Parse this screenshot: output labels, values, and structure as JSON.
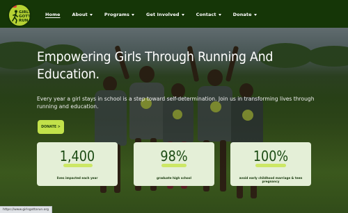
{
  "logo": {
    "pin_label": "Donate",
    "text_lines": [
      "GIRLS",
      "GOTTA",
      "RUN"
    ]
  },
  "nav": {
    "items": [
      {
        "label": "Home",
        "has_menu": false,
        "active": true
      },
      {
        "label": "About",
        "has_menu": true
      },
      {
        "label": "Programs",
        "has_menu": true
      },
      {
        "label": "Get Involved",
        "has_menu": true
      },
      {
        "label": "Contact",
        "has_menu": true
      },
      {
        "label": "Donate",
        "has_menu": true
      }
    ]
  },
  "hero": {
    "title": "Empowering Girls Through Running And Education.",
    "subtitle": "Every year a girl stays in school is a step toward self-determination. Join us in transforming lives through running and education.",
    "button_label": "DONATE >"
  },
  "stats": [
    {
      "value": "1,400",
      "label": "lives impacted each year"
    },
    {
      "value": "98%",
      "label": "graduate high school"
    },
    {
      "value": "100%",
      "label": "avoid early childhood marriage & teen pregnancy"
    }
  ],
  "status_url": "https://www.girlsgottarun.org",
  "colors": {
    "nav_bg": "#153607",
    "accent_lime": "#c2e14a",
    "card_bg": "#e4efd7",
    "stat_text": "#1a4a12"
  }
}
